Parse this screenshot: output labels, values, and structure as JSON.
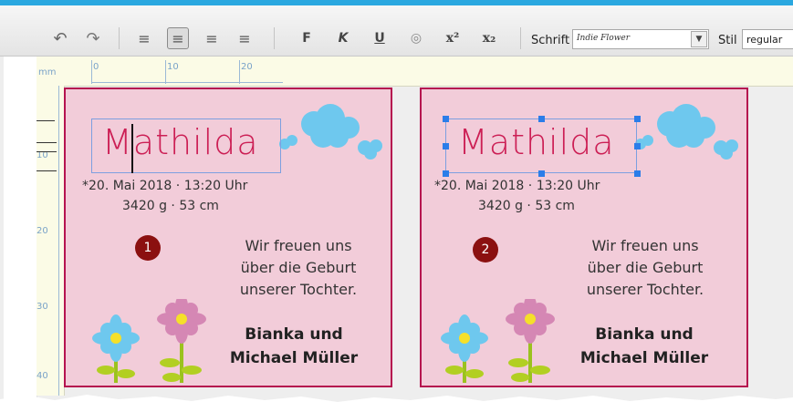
{
  "toolbar": {
    "buttons": [
      {
        "name": "undo-icon",
        "glyph": "↶"
      },
      {
        "name": "redo-icon",
        "glyph": "↷"
      },
      {
        "name": "align-left-icon",
        "glyph": "≡"
      },
      {
        "name": "align-center-icon",
        "glyph": "≡"
      },
      {
        "name": "align-right-icon",
        "glyph": "≡"
      },
      {
        "name": "align-justify-icon",
        "glyph": "≡"
      },
      {
        "name": "bold-icon",
        "glyph": "F"
      },
      {
        "name": "italic-icon",
        "glyph": "K"
      },
      {
        "name": "underline-icon",
        "glyph": "U"
      },
      {
        "name": "outline-icon",
        "glyph": "◎"
      },
      {
        "name": "superscript-icon",
        "glyph": "x²"
      },
      {
        "name": "subscript-icon",
        "glyph": "x₂"
      }
    ],
    "font_label": "Schrift",
    "font_value": "Indie Flower",
    "style_label": "Stil",
    "style_value": "regular"
  },
  "ruler": {
    "unit": "mm",
    "top_labels": [
      "0",
      "10",
      "20"
    ],
    "left_labels": [
      "10",
      "20",
      "30",
      "40"
    ]
  },
  "cards": [
    {
      "name": "Mathilda",
      "date": "*20. Mai 2018 · 13:20 Uhr",
      "weight": "3420 g · 53 cm",
      "badge": "1",
      "message_lines": [
        "Wir freuen uns",
        "über die Geburt",
        "unserer Tochter."
      ],
      "parents_lines": [
        "Bianka und",
        "Michael Müller"
      ]
    },
    {
      "name": "Mathilda",
      "date": "*20. Mai 2018 · 13:20 Uhr",
      "weight": "3420 g · 53 cm",
      "badge": "2",
      "message_lines": [
        "Wir freuen uns",
        "über die Geburt",
        "unserer Tochter."
      ],
      "parents_lines": [
        "Bianka und",
        "Michael Müller"
      ]
    }
  ],
  "colors": {
    "accent": "#2aa8e0",
    "card_bg": "#f2ccd9",
    "card_border": "#b5134f",
    "name_color": "#cc1f55",
    "badge": "#8b1010",
    "cloud": "#6ec8ee"
  }
}
